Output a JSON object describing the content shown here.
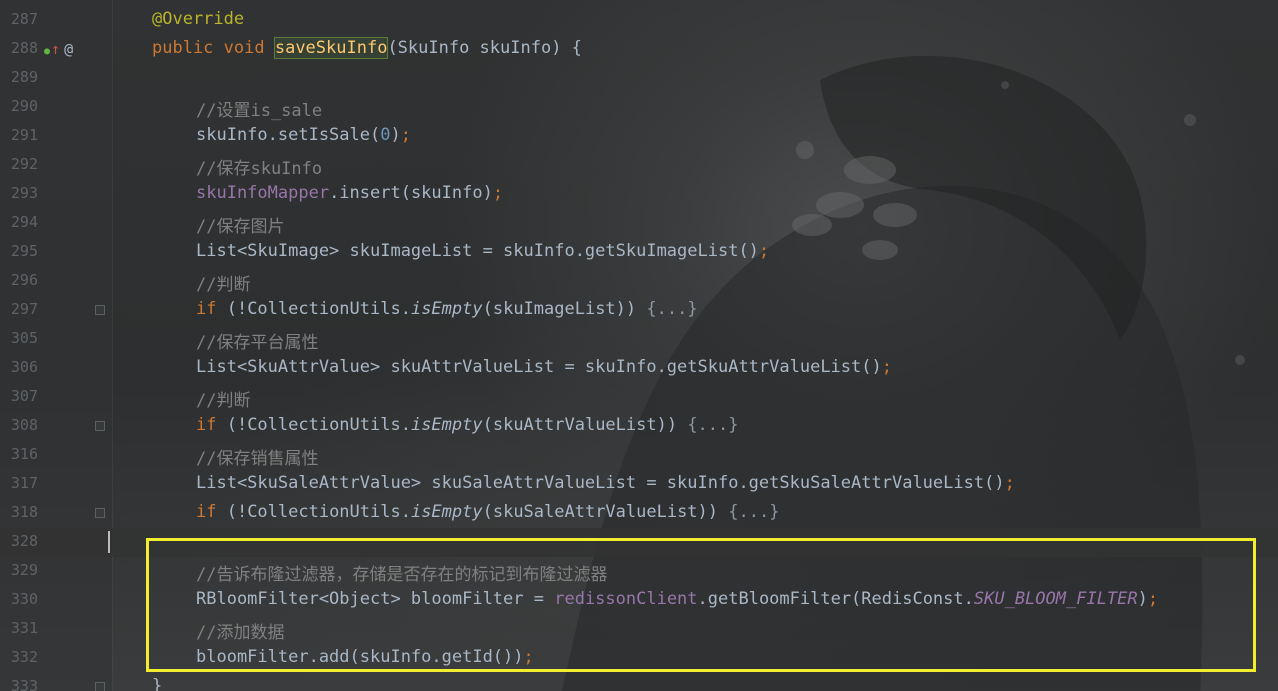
{
  "lines": [
    {
      "no": "287",
      "tokens": [
        [
          "k-ann",
          "@Override"
        ]
      ],
      "indent": 0
    },
    {
      "no": "288",
      "icons": true,
      "tokens": [
        [
          "k-kw",
          "public "
        ],
        [
          "k-kw",
          "void "
        ],
        [
          "hl-box",
          "saveSkuInfo"
        ],
        [
          "",
          "(SkuInfo skuInfo) {"
        ]
      ],
      "indent": 0
    },
    {
      "no": "289",
      "tokens": [],
      "indent": 0
    },
    {
      "no": "290",
      "tokens": [
        [
          "k-com",
          "//设置is_sale"
        ]
      ],
      "indent": 1
    },
    {
      "no": "291",
      "tokens": [
        [
          "",
          "skuInfo.setIsSale("
        ],
        [
          "k-num",
          "0"
        ],
        [
          "",
          ")"
        ],
        [
          "k-kw",
          ";"
        ]
      ],
      "indent": 1
    },
    {
      "no": "292",
      "tokens": [
        [
          "k-com",
          "//保存skuInfo"
        ]
      ],
      "indent": 1
    },
    {
      "no": "293",
      "tokens": [
        [
          "k-fld",
          "skuInfoMapper"
        ],
        [
          "",
          ".insert(skuInfo)"
        ],
        [
          "k-kw",
          ";"
        ]
      ],
      "indent": 1
    },
    {
      "no": "294",
      "tokens": [
        [
          "k-com",
          "//保存图片"
        ]
      ],
      "indent": 1
    },
    {
      "no": "295",
      "tokens": [
        [
          "",
          "List<SkuImage> skuImageList = skuInfo.getSkuImageList()"
        ],
        [
          "k-kw",
          ";"
        ]
      ],
      "indent": 1
    },
    {
      "no": "296",
      "tokens": [
        [
          "k-com",
          "//判断"
        ]
      ],
      "indent": 1
    },
    {
      "no": "297",
      "fold": true,
      "tokens": [
        [
          "k-kw",
          "if "
        ],
        [
          "",
          "(!CollectionUtils."
        ],
        [
          "k-ital",
          "isEmpty"
        ],
        [
          "",
          "(skuImageList)) "
        ],
        [
          "k-fold",
          "{...}"
        ]
      ],
      "indent": 1
    },
    {
      "no": "305",
      "tokens": [
        [
          "k-com",
          "//保存平台属性"
        ]
      ],
      "indent": 1
    },
    {
      "no": "306",
      "tokens": [
        [
          "",
          "List<SkuAttrValue> skuAttrValueList = skuInfo.getSkuAttrValueList()"
        ],
        [
          "k-kw",
          ";"
        ]
      ],
      "indent": 1
    },
    {
      "no": "307",
      "tokens": [
        [
          "k-com",
          "//判断"
        ]
      ],
      "indent": 1
    },
    {
      "no": "308",
      "fold": true,
      "tokens": [
        [
          "k-kw",
          "if "
        ],
        [
          "",
          "(!CollectionUtils."
        ],
        [
          "k-ital",
          "isEmpty"
        ],
        [
          "",
          "(skuAttrValueList)) "
        ],
        [
          "k-fold",
          "{...}"
        ]
      ],
      "indent": 1
    },
    {
      "no": "316",
      "tokens": [
        [
          "k-com",
          "//保存销售属性"
        ]
      ],
      "indent": 1
    },
    {
      "no": "317",
      "tokens": [
        [
          "",
          "List<SkuSaleAttrValue> skuSaleAttrValueList = skuInfo.getSkuSaleAttrValueList()"
        ],
        [
          "k-kw",
          ";"
        ]
      ],
      "indent": 1
    },
    {
      "no": "318",
      "fold": true,
      "tokens": [
        [
          "k-kw",
          "if "
        ],
        [
          "",
          "(!CollectionUtils."
        ],
        [
          "k-ital",
          "isEmpty"
        ],
        [
          "",
          "(skuSaleAttrValueList)) "
        ],
        [
          "k-fold",
          "{...}"
        ]
      ],
      "indent": 1
    },
    {
      "no": "328",
      "current": true,
      "tokens": [],
      "indent": 0
    },
    {
      "no": "329",
      "tokens": [
        [
          "k-com",
          "//告诉布隆过滤器，存储是否存在的标记到布隆过滤器"
        ]
      ],
      "indent": 1
    },
    {
      "no": "330",
      "tokens": [
        [
          "",
          "RBloomFilter<Object> bloomFilter = "
        ],
        [
          "k-fld",
          "redissonClient"
        ],
        [
          "",
          ".getBloomFilter(RedisConst."
        ],
        [
          "k-sfld",
          "SKU_BLOOM_FILTER"
        ],
        [
          "",
          ")"
        ],
        [
          "k-kw",
          ";"
        ]
      ],
      "indent": 1
    },
    {
      "no": "331",
      "tokens": [
        [
          "k-com",
          "//添加数据"
        ]
      ],
      "indent": 1
    },
    {
      "no": "332",
      "tokens": [
        [
          "",
          "bloomFilter.add(skuInfo.getId())"
        ],
        [
          "k-kw",
          ";"
        ]
      ],
      "indent": 1
    },
    {
      "no": "333",
      "fold": true,
      "tokens": [
        [
          "",
          "}"
        ]
      ],
      "indent": 0
    }
  ],
  "colors": {
    "highlight_frame": "#f2ee2f",
    "keyword": "#cc7832",
    "annotation": "#bbb529",
    "comment": "#808080",
    "field": "#9876aa",
    "method_decl": "#ffc66d",
    "number": "#6897bb",
    "text": "#a9b7c6"
  },
  "gutter_icons": [
    "implements-icon",
    "overrides-up-arrow-icon",
    "annotation-at-icon"
  ]
}
